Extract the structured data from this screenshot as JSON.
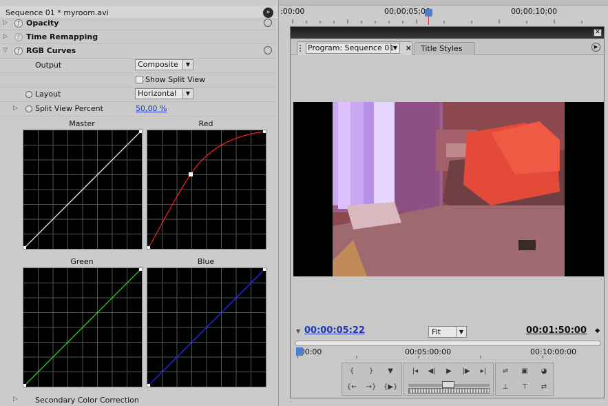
{
  "effect_controls": {
    "sequence_title": "Sequence 01 * myroom.avi",
    "rows": {
      "opacity": "Opacity",
      "time_remapping": "Time Remapping",
      "rgb_curves": "RGB Curves"
    },
    "props": {
      "output_label": "Output",
      "output_value": "Composite",
      "show_split_view": "Show Split View",
      "layout_label": "Layout",
      "layout_value": "Horizontal",
      "split_view_label": "Split View Percent",
      "split_view_value": "50,00 %"
    },
    "curves": {
      "master": "Master",
      "red": "Red",
      "green": "Green",
      "blue": "Blue"
    },
    "secondary": "Secondary Color Correction"
  },
  "timeline_ruler": {
    "t0": ":00:00",
    "t1": "00;00;05;00",
    "t2": "00;00;10;00"
  },
  "program_monitor": {
    "tab_label": "Program: Sequence 01",
    "tab2_label": "Title Styles",
    "current_time": "00:00:05:22",
    "zoom": "Fit",
    "duration": "00:01:50:00",
    "mini_t0": ":00:00",
    "mini_t1": "00:05:00:00",
    "mini_t2": "00:10:00:00"
  },
  "colors": {
    "timecode_blue": "#1d35b8",
    "playhead": "#4a7fd4",
    "curve_master": "#ffffff",
    "curve_red": "#ff2020",
    "curve_green": "#40d040",
    "curve_blue": "#2030ff"
  }
}
